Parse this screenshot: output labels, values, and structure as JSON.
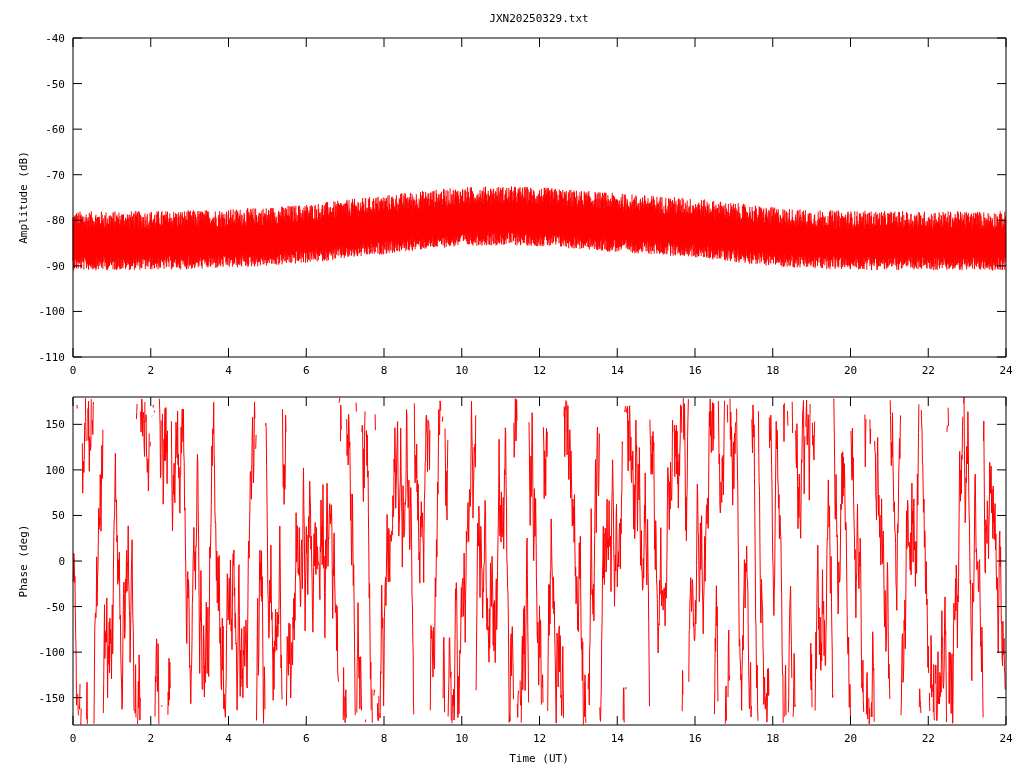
{
  "title": "JXN20250329.txt",
  "panels": [
    {
      "kind": "amplitude",
      "ylabel": "Amplitude (dB)",
      "yticks": [
        "-40",
        "-50",
        "-60",
        "-70",
        "-80",
        "-90",
        "-100",
        "-110"
      ],
      "xticks": [
        "0",
        "2",
        "4",
        "6",
        "8",
        "10",
        "12",
        "14",
        "16",
        "18",
        "20",
        "22",
        "24"
      ]
    },
    {
      "kind": "phase",
      "ylabel": "Phase (deg)",
      "yticks": [
        "150",
        "100",
        "50",
        "0",
        "-50",
        "-100",
        "-150"
      ],
      "xticks": [
        "0",
        "2",
        "4",
        "6",
        "8",
        "10",
        "12",
        "14",
        "16",
        "18",
        "20",
        "22",
        "24"
      ],
      "xlabel": "Time (UT)"
    }
  ]
}
